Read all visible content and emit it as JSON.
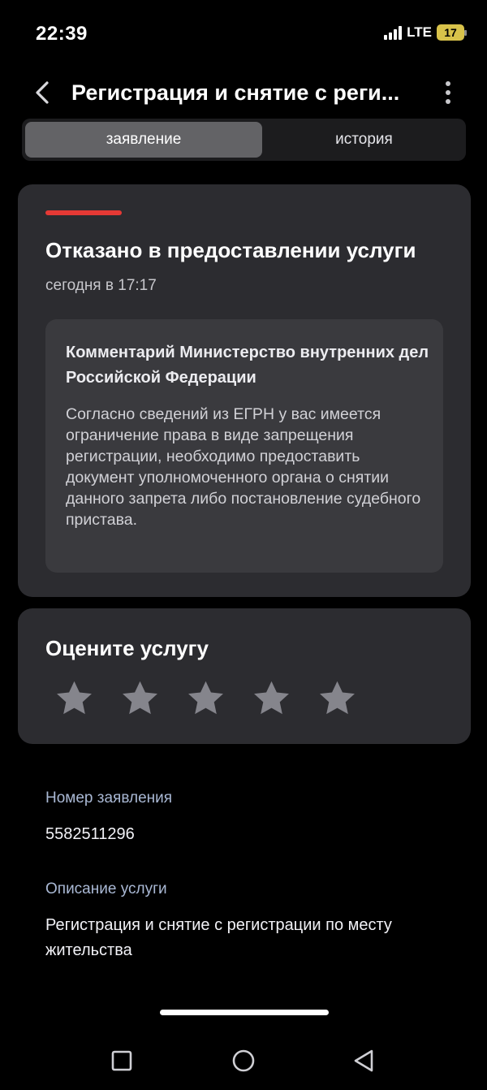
{
  "status_bar": {
    "time": "22:39",
    "network": "LTE",
    "battery": "17"
  },
  "header": {
    "title": "Регистрация и снятие с реги...",
    "back_icon": "chevron-left-icon",
    "menu_icon": "more-vertical-icon"
  },
  "tabs": [
    {
      "label": "заявление",
      "active": true
    },
    {
      "label": "история",
      "active": false
    }
  ],
  "status_card": {
    "accent_color": "#e53935",
    "title": "Отказано в предоставлении услуги",
    "time": "сегодня в 17:17",
    "comment": {
      "title": "Комментарий Министерство внутренних дел Российской Федерации",
      "body": "Согласно сведений из ЕГРН у вас имеется ограничение права в виде запрещения регистрации, необходимо предоставить документ уполномоченного органа о снятии данного запрета либо постановление судебного пристава."
    }
  },
  "rating": {
    "title": "Оцените услугу",
    "max": 5,
    "value": 0
  },
  "details": {
    "number_label": "Номер заявления",
    "number_value": "5582511296",
    "description_label": "Описание услуги",
    "description_value": "Регистрация и снятие с регистрации по месту жительства"
  },
  "nav": {
    "recents_icon": "square-icon",
    "home_icon": "circle-icon",
    "back_icon": "triangle-back-icon"
  }
}
